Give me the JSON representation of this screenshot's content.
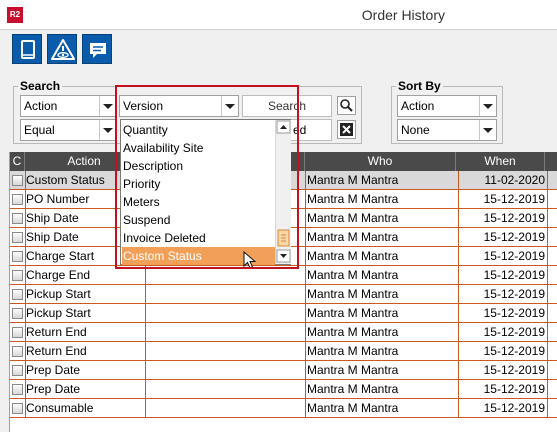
{
  "window": {
    "app_badge": "R2",
    "title": "Order History"
  },
  "toolbar": {
    "icons": [
      "document-icon",
      "warning-eye-icon",
      "comment-icon"
    ]
  },
  "search": {
    "label": "Search",
    "field_combo": "Action",
    "column_combo": "Version",
    "operator_combo": "Equal",
    "search_button": "Search",
    "hidden_value_fragment": "ed"
  },
  "sort": {
    "label": "Sort By",
    "primary": "Action",
    "secondary": "None"
  },
  "dropdown": {
    "items": [
      "Quantity",
      "Availability Site",
      "Description",
      "Priority",
      "Meters",
      "Suspend",
      "Invoice Deleted",
      "Custom Status"
    ],
    "highlighted_index": 7,
    "highlight_color": "#f2a057"
  },
  "table": {
    "columns": {
      "check": "C",
      "action": "Action",
      "who": "Who",
      "when": "When"
    },
    "rows": [
      {
        "action": "Custom Status",
        "who": "Mantra M Mantra",
        "when": "11-02-2020",
        "selected": true
      },
      {
        "action": "PO Number",
        "who": "Mantra M Mantra",
        "when": "15-12-2019"
      },
      {
        "action": "Ship Date",
        "who": "Mantra M Mantra",
        "when": "15-12-2019"
      },
      {
        "action": "Ship Date",
        "who": "Mantra M Mantra",
        "when": "15-12-2019"
      },
      {
        "action": "Charge Start",
        "who": "Mantra M Mantra",
        "when": "15-12-2019"
      },
      {
        "action": "Charge End",
        "who": "Mantra M Mantra",
        "when": "15-12-2019"
      },
      {
        "action": "Pickup Start",
        "who": "Mantra M Mantra",
        "when": "15-12-2019"
      },
      {
        "action": "Pickup Start",
        "who": "Mantra M Mantra",
        "when": "15-12-2019"
      },
      {
        "action": "Return End",
        "who": "Mantra M Mantra",
        "when": "15-12-2019"
      },
      {
        "action": "Return End",
        "who": "Mantra M Mantra",
        "when": "15-12-2019"
      },
      {
        "action": "Prep Date",
        "who": "Mantra M Mantra",
        "when": "15-12-2019"
      },
      {
        "action": "Prep Date",
        "who": "Mantra M Mantra",
        "when": "15-12-2019"
      },
      {
        "action": "Consumable",
        "who": "Mantra M Mantra",
        "when": "15-12-2019"
      }
    ]
  },
  "colors": {
    "toolbar_blue": "#0a5cab",
    "header_dark": "#4a4a4a",
    "row_rule": "#c85a1e",
    "callout_red": "#c1121f"
  }
}
